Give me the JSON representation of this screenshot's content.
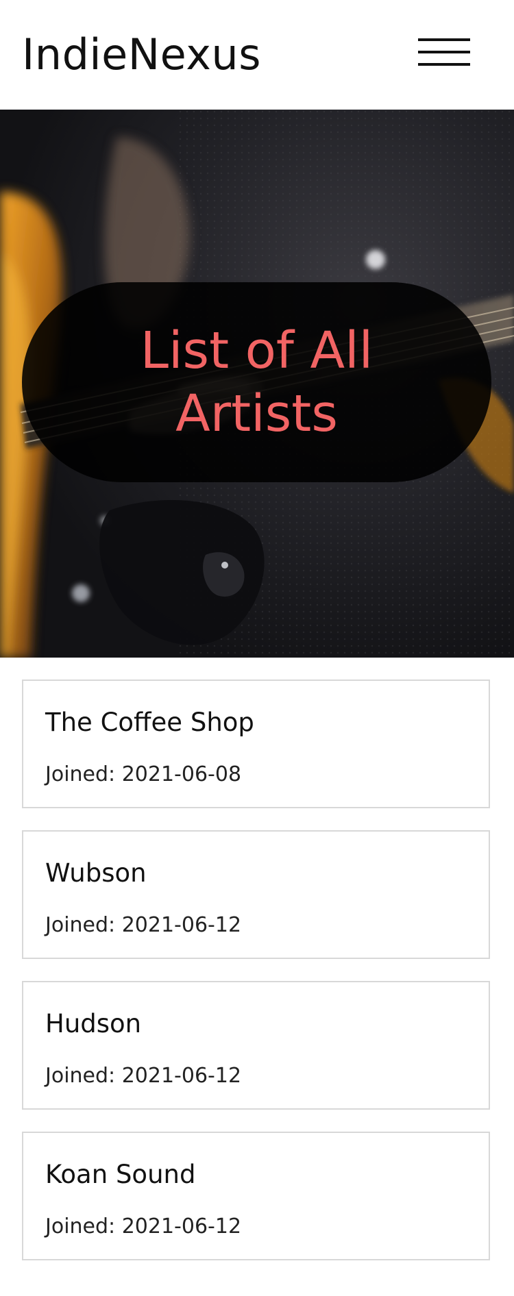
{
  "header": {
    "brand": "IndieNexus",
    "menu_icon": "hamburger-menu-icon"
  },
  "hero": {
    "title": "List of All Artists",
    "title_color": "#f26464",
    "background_image": "electric guitar close-up, dark background"
  },
  "artists": [
    {
      "name": "The Coffee Shop",
      "joined": "Joined: 2021-06-08"
    },
    {
      "name": "Wubson",
      "joined": "Joined: 2021-06-12"
    },
    {
      "name": "Hudson",
      "joined": "Joined: 2021-06-12"
    },
    {
      "name": "Koan Sound",
      "joined": "Joined: 2021-06-12"
    }
  ]
}
